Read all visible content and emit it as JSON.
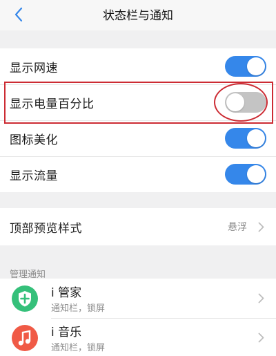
{
  "header": {
    "title": "状态栏与通知",
    "back_icon": "chevron-left-icon"
  },
  "toggles": [
    {
      "label": "显示网速",
      "state": "on"
    },
    {
      "label": "显示电量百分比",
      "state": "off"
    },
    {
      "label": "图标美化",
      "state": "on"
    },
    {
      "label": "显示流量",
      "state": "on"
    }
  ],
  "preview": {
    "label": "顶部预览样式",
    "value": "悬浮"
  },
  "notifications": {
    "section_label": "管理通知",
    "apps": [
      {
        "name": "i 管家",
        "subtitle": "通知栏，锁屏",
        "icon": "shield-app-icon"
      },
      {
        "name": "i 音乐",
        "subtitle": "通知栏，锁屏",
        "icon": "music-app-icon"
      }
    ]
  },
  "colors": {
    "accent": "#3587ea",
    "toggle_off": "#c4c4c4",
    "highlight": "#cc2b33",
    "background": "#f0f0f1"
  }
}
